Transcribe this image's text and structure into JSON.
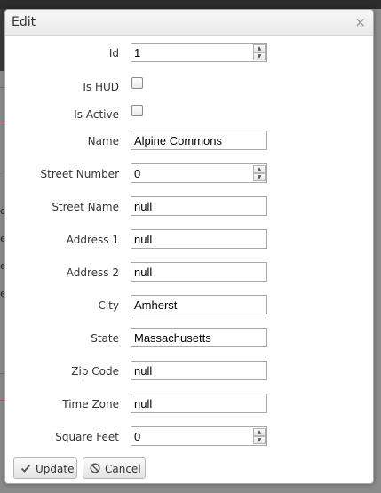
{
  "background": {
    "truncated_labels": [
      "e",
      "e",
      "e",
      "e"
    ]
  },
  "dialog": {
    "title": "Edit",
    "close_glyph": "×",
    "fields": {
      "id": {
        "label": "Id",
        "value": "1"
      },
      "is_hud": {
        "label": "Is HUD",
        "checked": false
      },
      "is_active": {
        "label": "Is Active",
        "checked": false
      },
      "name": {
        "label": "Name",
        "value": "Alpine Commons"
      },
      "street_number": {
        "label": "Street Number",
        "value": "0"
      },
      "street_name": {
        "label": "Street Name",
        "value": "null"
      },
      "address1": {
        "label": "Address 1",
        "value": "null"
      },
      "address2": {
        "label": "Address 2",
        "value": "null"
      },
      "city": {
        "label": "City",
        "value": "Amherst"
      },
      "state": {
        "label": "State",
        "value": "Massachusetts"
      },
      "zip": {
        "label": "Zip Code",
        "value": "null"
      },
      "timezone": {
        "label": "Time Zone",
        "value": "null"
      },
      "sqft": {
        "label": "Square Feet",
        "value": "0"
      }
    },
    "spinner": {
      "up": "▲",
      "down": "▼"
    },
    "buttons": {
      "update": {
        "label": "Update",
        "icon": "check-icon"
      },
      "cancel": {
        "label": "Cancel",
        "icon": "cancel-icon"
      }
    }
  }
}
